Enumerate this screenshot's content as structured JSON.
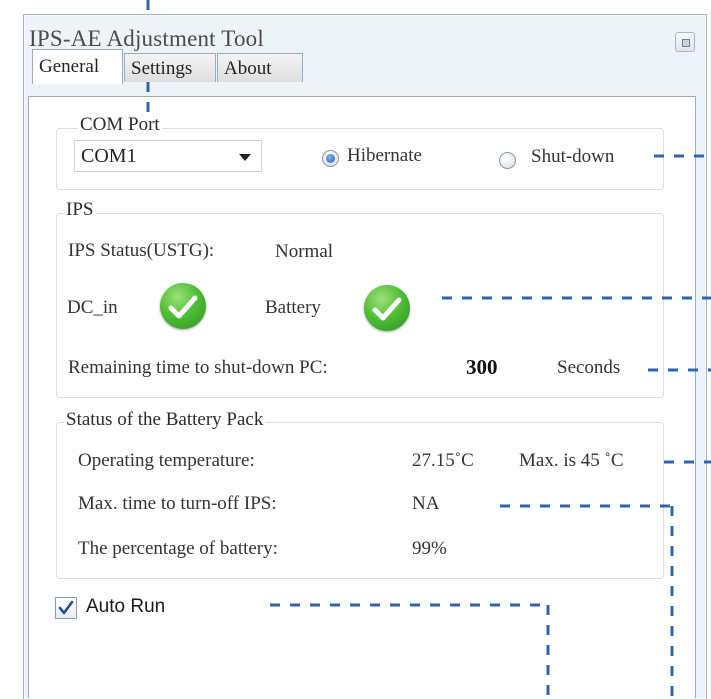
{
  "window": {
    "title": "IPS-AE Adjustment Tool"
  },
  "tabs": [
    {
      "label": "General",
      "active": true
    },
    {
      "label": "Settings",
      "active": false
    },
    {
      "label": "About",
      "active": false
    }
  ],
  "com_port": {
    "group_label": "COM Port",
    "selected": "COM1",
    "radio_hibernate": {
      "label": "Hibernate",
      "checked": true
    },
    "radio_shutdown": {
      "label": "Shut-down",
      "checked": false
    }
  },
  "ips": {
    "group_label": "IPS",
    "status_label": "IPS Status(USTG):",
    "status_value": "Normal",
    "dc_in_label": "DC_in",
    "battery_label": "Battery",
    "remaining_label": "Remaining time to shut-down PC:",
    "remaining_value": "300",
    "remaining_unit": "Seconds"
  },
  "battery_pack": {
    "group_label": "Status of the Battery Pack",
    "temp_label": "Operating temperature:",
    "temp_value": "27.15˚C",
    "temp_max": "Max. is 45 ˚C",
    "maxtime_label": "Max. time to turn-off IPS:",
    "maxtime_value": "NA",
    "percent_label": "The percentage of battery:",
    "percent_value": "99%"
  },
  "auto_run": {
    "label": "Auto Run",
    "checked": true
  },
  "colors": {
    "annotation": "#2e64ad",
    "check_green": "#4fbf36",
    "radio_selected": "#1d5fb3",
    "window_border": "#9fb2cc"
  },
  "icons": [
    "restore-icon",
    "dropdown-arrow-icon",
    "checkmark-icon",
    "checkbox-check-icon"
  ]
}
